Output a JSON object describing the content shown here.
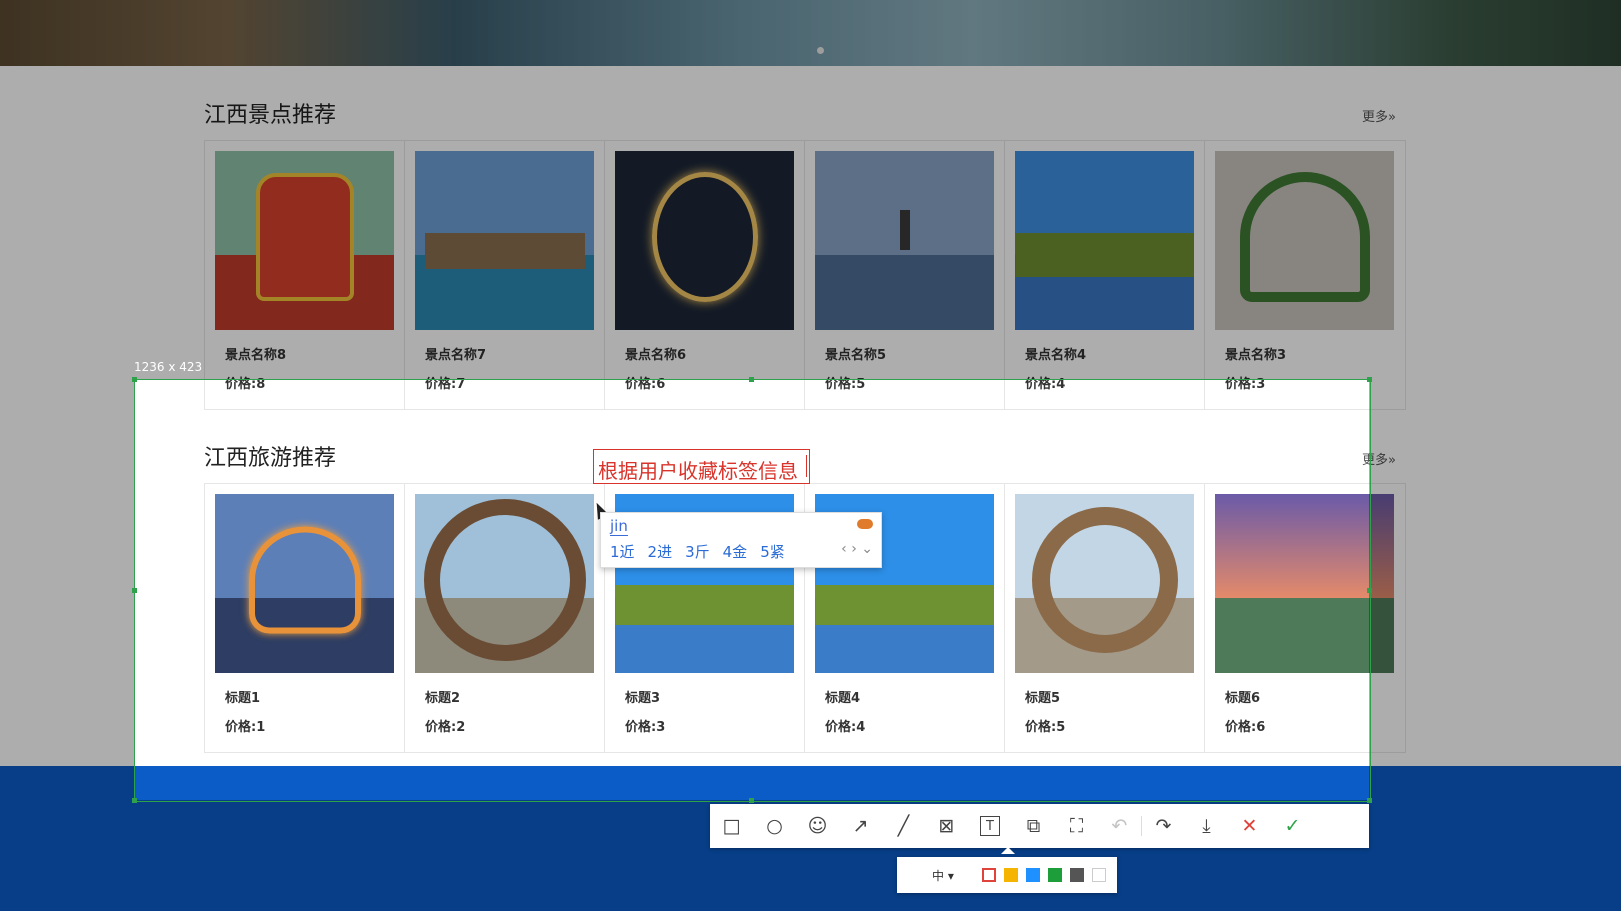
{
  "section1": {
    "title": "江西景点推荐",
    "more": "更多»",
    "cards": [
      {
        "title": "景点名称8",
        "price": "价格:8"
      },
      {
        "title": "景点名称7",
        "price": "价格:7"
      },
      {
        "title": "景点名称6",
        "price": "价格:6"
      },
      {
        "title": "景点名称5",
        "price": "价格:5"
      },
      {
        "title": "景点名称4",
        "price": "价格:4"
      },
      {
        "title": "景点名称3",
        "price": "价格:3"
      }
    ]
  },
  "section2": {
    "title": "江西旅游推荐",
    "more": "更多»",
    "cards": [
      {
        "title": "标题1",
        "price": "价格:1"
      },
      {
        "title": "标题2",
        "price": "价格:2"
      },
      {
        "title": "标题3",
        "price": "价格:3"
      },
      {
        "title": "标题4",
        "price": "价格:4"
      },
      {
        "title": "标题5",
        "price": "价格:5"
      },
      {
        "title": "标题6",
        "price": "价格:6"
      }
    ]
  },
  "screenshot_tool": {
    "selection_size": "1236 x 423",
    "annotation_text": "根据用户收藏标签信息",
    "ime": {
      "input": "jin",
      "candidates": [
        "1近",
        "2进",
        "3斤",
        "4金",
        "5紧"
      ],
      "arrows": "‹ › ⌄"
    },
    "toolbar": {
      "rectangle_icon": "□",
      "ellipse_icon": "○",
      "emoji_icon": "☺",
      "arrow_icon": "↗",
      "line_icon": "╱",
      "mosaic_icon": "⊠",
      "text_icon": "T",
      "pin_icon": "⧉",
      "ocr_icon": "⛶",
      "undo_icon": "↶",
      "redo_icon": "↷",
      "save_icon": "⤓",
      "cancel_icon": "✕",
      "confirm_icon": "✓"
    },
    "subbar": {
      "size_label": "中 ▾",
      "colors": [
        "#e0433b",
        "#f5b400",
        "#1e90ff",
        "#1e9e3a",
        "#555555",
        "#ffffff"
      ],
      "selected_color": "#e0433b"
    }
  }
}
